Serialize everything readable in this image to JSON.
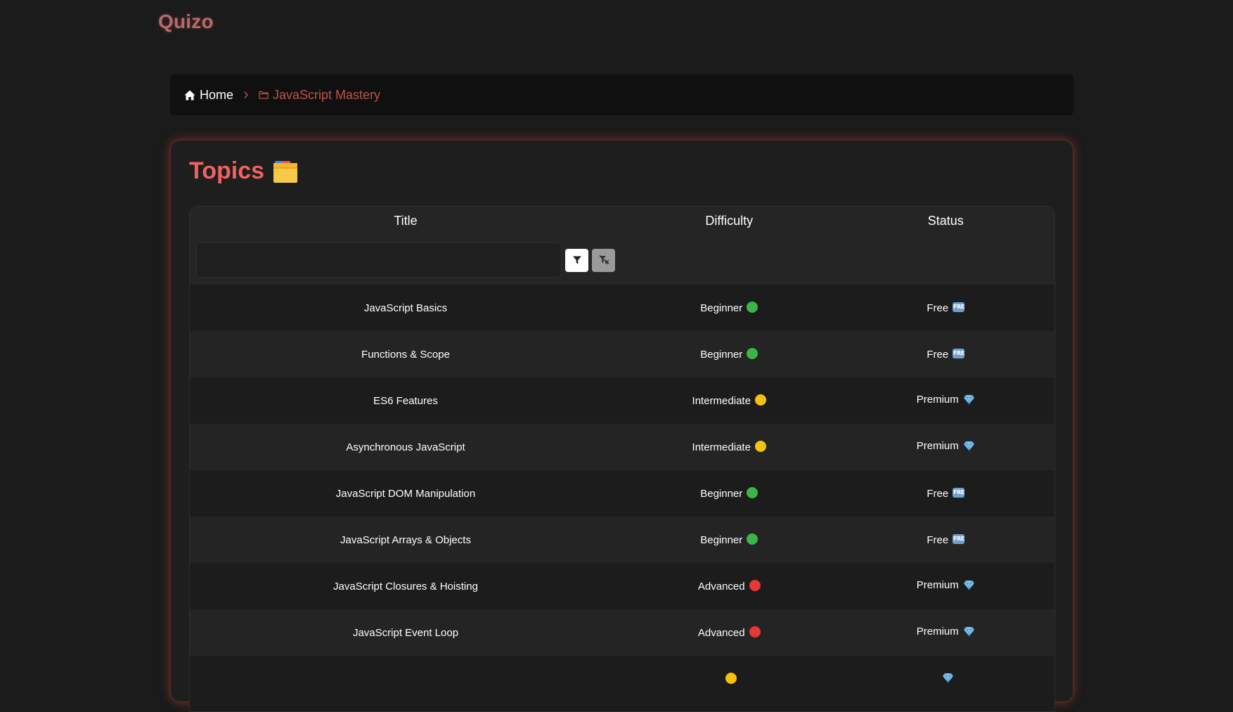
{
  "app": {
    "logo": "Quizo"
  },
  "breadcrumb": {
    "home_label": "Home",
    "current_label": "JavaScript Mastery"
  },
  "topics": {
    "heading": "Topics",
    "columns": {
      "title": "Title",
      "difficulty": "Difficulty",
      "status": "Status"
    },
    "filter": {
      "value": "",
      "placeholder": ""
    },
    "rows": [
      {
        "title": "JavaScript Basics",
        "difficulty": "Beginner",
        "difficulty_color": "#3bb54a",
        "status": "Free",
        "status_icon": "free-badge-icon"
      },
      {
        "title": "Functions & Scope",
        "difficulty": "Beginner",
        "difficulty_color": "#3bb54a",
        "status": "Free",
        "status_icon": "free-badge-icon"
      },
      {
        "title": "ES6 Features",
        "difficulty": "Intermediate",
        "difficulty_color": "#f4c20d",
        "status": "Premium",
        "status_icon": "gem-icon"
      },
      {
        "title": "Asynchronous JavaScript",
        "difficulty": "Intermediate",
        "difficulty_color": "#f4c20d",
        "status": "Premium",
        "status_icon": "gem-icon"
      },
      {
        "title": "JavaScript DOM Manipulation",
        "difficulty": "Beginner",
        "difficulty_color": "#3bb54a",
        "status": "Free",
        "status_icon": "free-badge-icon"
      },
      {
        "title": "JavaScript Arrays & Objects",
        "difficulty": "Beginner",
        "difficulty_color": "#3bb54a",
        "status": "Free",
        "status_icon": "free-badge-icon"
      },
      {
        "title": "JavaScript Closures & Hoisting",
        "difficulty": "Advanced",
        "difficulty_color": "#e53935",
        "status": "Premium",
        "status_icon": "gem-icon"
      },
      {
        "title": "JavaScript Event Loop",
        "difficulty": "Advanced",
        "difficulty_color": "#e53935",
        "status": "Premium",
        "status_icon": "gem-icon"
      },
      {
        "title": "",
        "difficulty": "",
        "difficulty_color": "#f4c20d",
        "status": "",
        "status_icon": "gem-icon"
      }
    ]
  },
  "colors": {
    "accent": "#f0625e",
    "logo": "#b86a6a",
    "breadcrumb_active": "#c0504d",
    "background": "#1b1b1b"
  }
}
